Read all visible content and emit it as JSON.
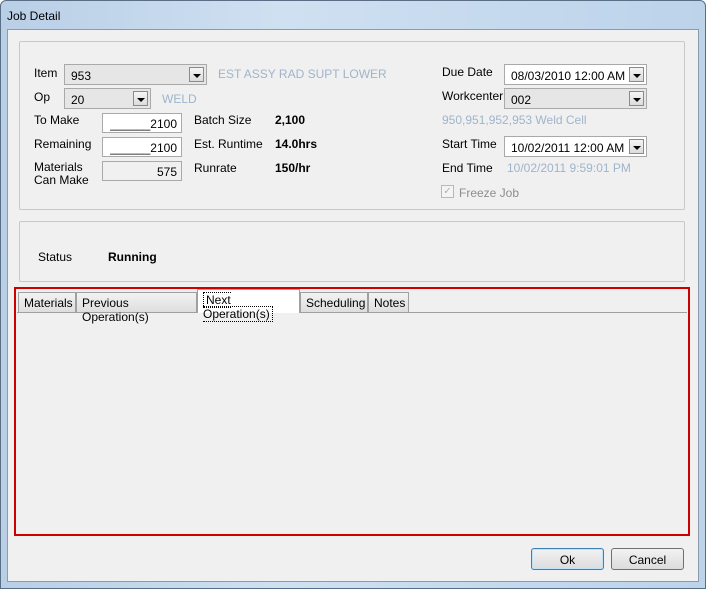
{
  "window": {
    "title": "Job Detail"
  },
  "form": {
    "item_label": "Item",
    "item_value": "953",
    "item_desc": "EST ASSY RAD SUPT LOWER",
    "op_label": "Op",
    "op_value": "20",
    "op_desc": "WELD",
    "to_make_label": "To Make",
    "to_make_value": "______2100",
    "remaining_label": "Remaining",
    "remaining_value": "______2100",
    "materials_label_1": "Materials",
    "materials_label_2": "Can Make",
    "materials_value": "575",
    "batch_size_label": "Batch Size",
    "batch_size_value": "2,100",
    "est_runtime_label": "Est. Runtime",
    "est_runtime_value": "14.0hrs",
    "runrate_label": "Runrate",
    "runrate_value": "150/hr",
    "due_date_label": "Due Date",
    "due_date_value": "08/03/2010 12:00 AM",
    "workcenter_label": "Workcenter",
    "workcenter_value": "002",
    "workcenter_desc": "950,951,952,953 Weld Cell",
    "start_time_label": "Start Time",
    "start_time_value": "10/02/2011 12:00 AM",
    "end_time_label": "End Time",
    "end_time_value": "10/02/2011 9:59:01 PM",
    "freeze_job_label": "Freeze Job",
    "freeze_job_checked": true
  },
  "status": {
    "label": "Status",
    "value": "Running"
  },
  "tabs": [
    {
      "label": "Materials"
    },
    {
      "label": "Previous Operation(s)"
    },
    {
      "label": "Next Operation(s)",
      "active": true
    },
    {
      "label": "Scheduling"
    },
    {
      "label": "Notes"
    }
  ],
  "buttons": {
    "ok": "Ok",
    "cancel": "Cancel"
  },
  "colors": {
    "highlight_border": "#cc0000",
    "faint_text": "#9fb4cc"
  }
}
